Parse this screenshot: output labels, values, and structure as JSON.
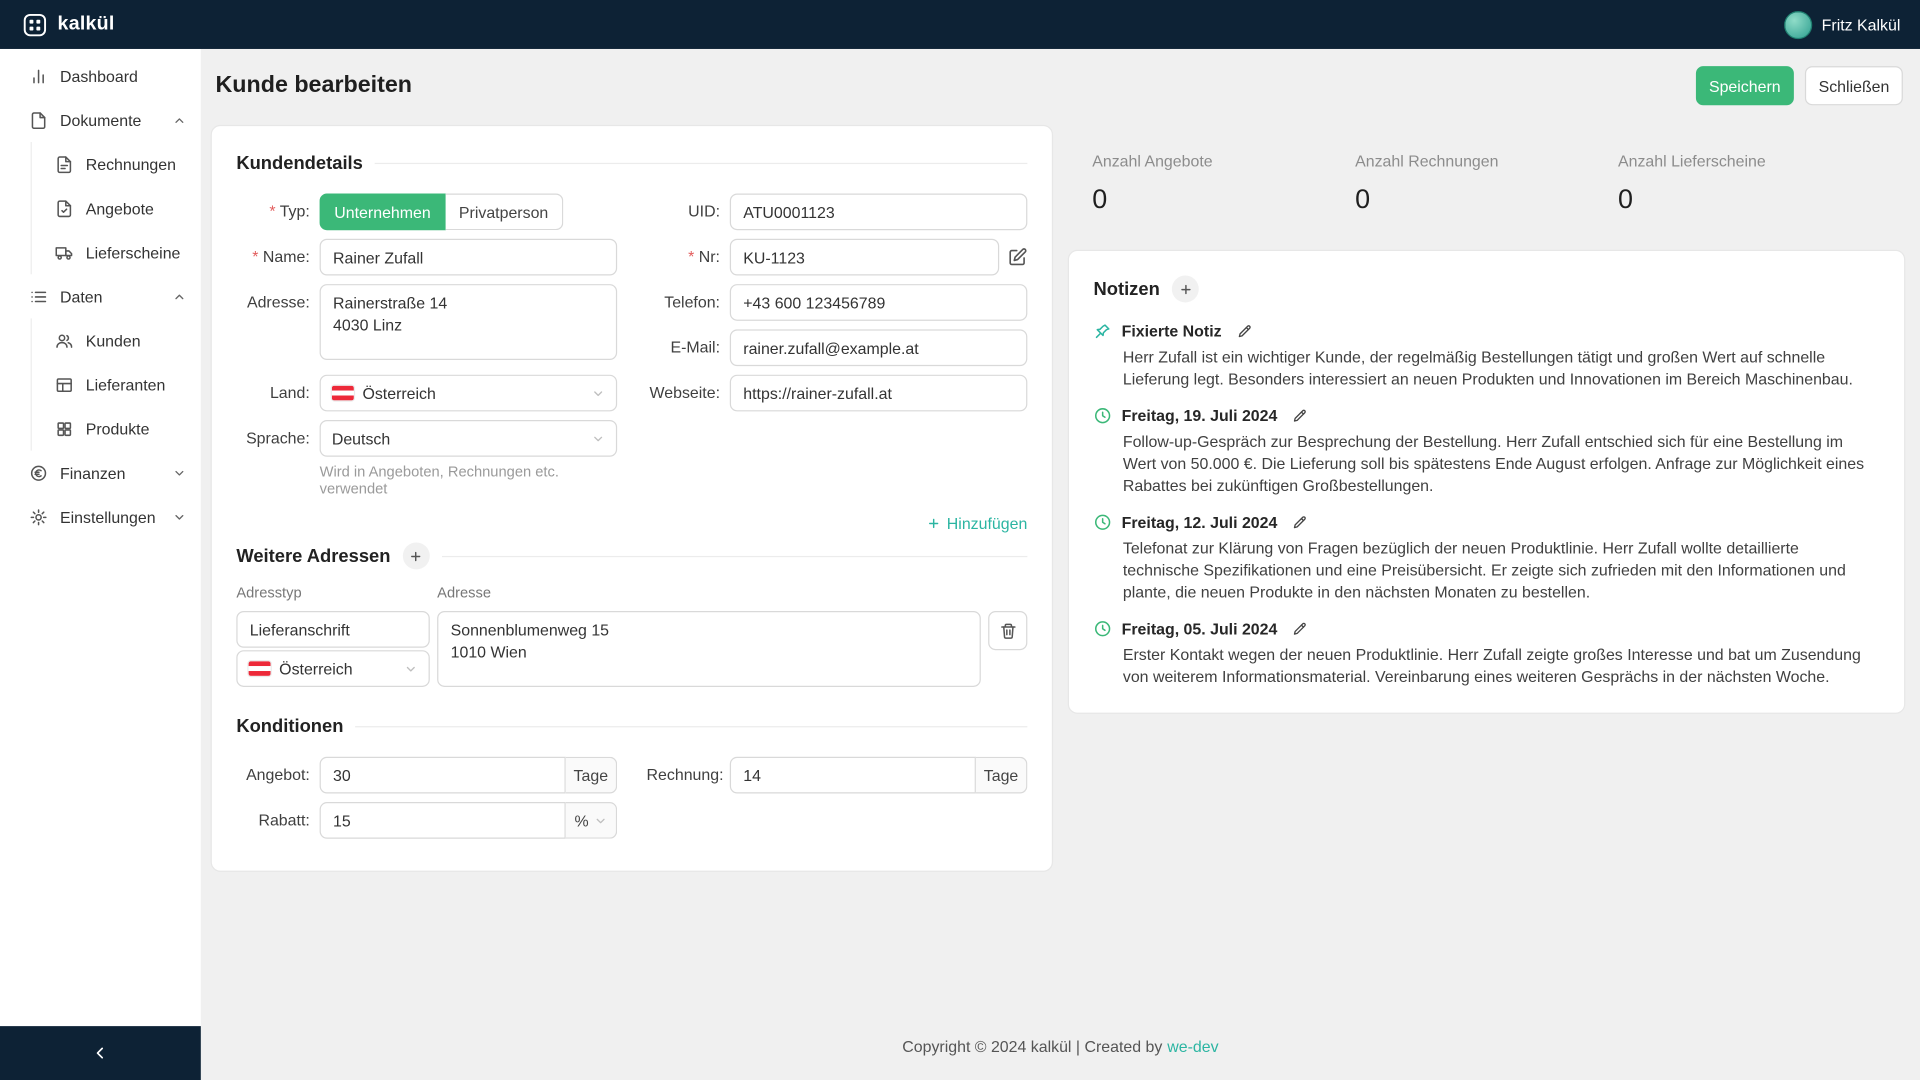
{
  "topbar": {
    "brand": "kalkül",
    "user_name": "Fritz Kalkül"
  },
  "sidebar": {
    "items": {
      "dashboard": "Dashboard",
      "dokumente": "Dokumente",
      "rechnungen": "Rechnungen",
      "angebote": "Angebote",
      "lieferscheine": "Lieferscheine",
      "daten": "Daten",
      "kunden": "Kunden",
      "lieferanten": "Lieferanten",
      "produkte": "Produkte",
      "finanzen": "Finanzen",
      "einstellungen": "Einstellungen"
    }
  },
  "page": {
    "title": "Kunde bearbeiten",
    "save_button": "Speichern",
    "close_button": "Schließen"
  },
  "kundendetails": {
    "section_title": "Kundendetails",
    "typ_label": "Typ:",
    "typ_unternehmen": "Unternehmen",
    "typ_privatperson": "Privatperson",
    "name_label": "Name:",
    "name_value": "Rainer Zufall",
    "adresse_label": "Adresse:",
    "adresse_value": "Rainerstraße 14\n4030 Linz",
    "land_label": "Land:",
    "land_value": "Österreich",
    "sprache_label": "Sprache:",
    "sprache_value": "Deutsch",
    "sprache_hint": "Wird in Angeboten, Rechnungen etc. verwendet",
    "uid_label": "UID:",
    "uid_value": "ATU0001123",
    "nr_label": "Nr:",
    "nr_value": "KU-1123",
    "telefon_label": "Telefon:",
    "telefon_value": "+43 600 123456789",
    "email_label": "E-Mail:",
    "email_value": "rainer.zufall@example.at",
    "webseite_label": "Webseite:",
    "webseite_value": "https://rainer-zufall.at"
  },
  "weitere_adressen": {
    "section_title": "Weitere Adressen",
    "add_link": "Hinzufügen",
    "col_adresstyp": "Adresstyp",
    "col_adresse": "Adresse",
    "row_adresstyp": "Lieferanschrift",
    "row_land": "Österreich",
    "row_adresse": "Sonnenblumenweg 15\n1010 Wien"
  },
  "konditionen": {
    "section_title": "Konditionen",
    "angebot_label": "Angebot:",
    "angebot_value": "30",
    "angebot_suffix": "Tage",
    "rechnung_label": "Rechnung:",
    "rechnung_value": "14",
    "rechnung_suffix": "Tage",
    "rabatt_label": "Rabatt:",
    "rabatt_value": "15",
    "rabatt_suffix": "%"
  },
  "stats": [
    {
      "label": "Anzahl Angebote",
      "value": "0"
    },
    {
      "label": "Anzahl Rechnungen",
      "value": "0"
    },
    {
      "label": "Anzahl Lieferscheine",
      "value": "0"
    }
  ],
  "notizen": {
    "section_title": "Notizen",
    "entries": [
      {
        "icon": "pin-icon",
        "title": "Fixierte Notiz",
        "text": "Herr Zufall ist ein wichtiger Kunde, der regelmäßig Bestellungen tätigt und großen Wert auf schnelle Lieferung legt. Besonders interessiert an neuen Produkten und Innovationen im Bereich Maschinenbau."
      },
      {
        "icon": "clock-icon",
        "title": "Freitag, 19. Juli 2024",
        "text": "Follow-up-Gespräch zur Besprechung der Bestellung. Herr Zufall entschied sich für eine Bestellung im Wert von 50.000 €. Die Lieferung soll bis spätestens Ende August erfolgen. Anfrage zur Möglichkeit eines Rabattes bei zukünftigen Großbestellungen."
      },
      {
        "icon": "clock-icon",
        "title": "Freitag, 12. Juli 2024",
        "text": "Telefonat zur Klärung von Fragen bezüglich der neuen Produktlinie. Herr Zufall wollte detaillierte technische Spezifikationen und eine Preisübersicht. Er zeigte sich zufrieden mit den Informationen und plante, die neuen Produkte in den nächsten Monaten zu bestellen."
      },
      {
        "icon": "clock-icon",
        "title": "Freitag, 05. Juli 2024",
        "text": "Erster Kontakt wegen der neuen Produktlinie. Herr Zufall zeigte großes Interesse und bat um Zusendung von weiterem Informationsmaterial. Vereinbarung eines weiteren Gesprächs in der nächsten Woche."
      }
    ]
  },
  "footer": {
    "copyright": "Copyright © 2024 kalkül | Created by",
    "link": "we-dev"
  },
  "colors": {
    "primary_green": "#3bb878",
    "accent_teal": "#2bb5a2",
    "topbar_navy": "#0d2235",
    "required_red": "#e25c5c"
  }
}
